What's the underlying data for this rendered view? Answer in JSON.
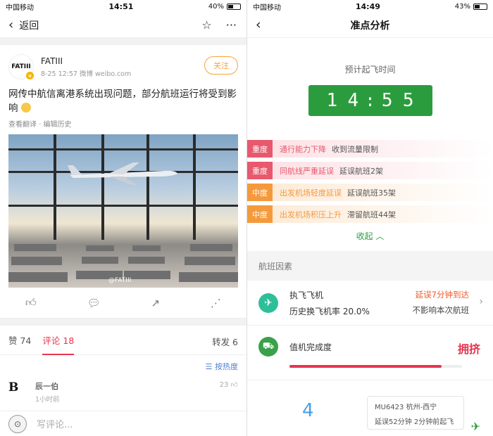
{
  "left": {
    "status": {
      "carrier": "中国移动",
      "time": "14:51",
      "battery": "40%",
      "battery_level": 0.4
    },
    "nav": {
      "back_label": "返回",
      "star_icon": "star-icon",
      "more_icon": "more-icon"
    },
    "post": {
      "avatar_text": "FATIII",
      "author": "FATIII",
      "meta": "8-25 12:57  微博 weibo.com",
      "follow_label": "关注",
      "text": "网传中航信离港系统出现问题，部分航班运行将受到影响",
      "sub": "查看翻译 · 编辑历史",
      "watermark": "@FATIII"
    },
    "tabs": {
      "likes": "赞 74",
      "comments": "评论 18",
      "reposts": "转发 6"
    },
    "sort_label": "按热度",
    "comment": {
      "avatar": "B",
      "name": "辰一伯",
      "time": "1小时前",
      "likes": "23"
    },
    "input_placeholder": "写评论..."
  },
  "right": {
    "status": {
      "carrier": "中国移动",
      "time": "14:49",
      "battery": "43%",
      "battery_level": 0.43
    },
    "title": "准点分析",
    "departure_label": "预计起飞时间",
    "departure_digits": [
      "1",
      "4",
      "5",
      "5"
    ],
    "factors": [
      {
        "severity": "重度",
        "title": "通行能力下降",
        "detail": "收到流量限制",
        "color": "#e8596e",
        "bg": "#fde2e6"
      },
      {
        "severity": "重度",
        "title": "同航线严重延误",
        "detail": "延误航班2架",
        "color": "#e8596e",
        "bg": "#fde2e6"
      },
      {
        "severity": "中度",
        "title": "出发机场轻度延误",
        "detail": "延误航班35架",
        "color": "#f59a3c",
        "bg": "#fdebd8"
      },
      {
        "severity": "中度",
        "title": "出发机场积压上升",
        "detail": "滞留航班44架",
        "color": "#f59a3c",
        "bg": "#fdebd8"
      }
    ],
    "collapse_label": "收起 ︿",
    "section_title": "航班因素",
    "aircraft": {
      "title": "执飞飞机",
      "sub": "历史换飞机率 20.0%",
      "delay": "延误7分钟到达",
      "note": "不影响本次航班"
    },
    "checkin": {
      "label": "值机完成度",
      "status": "拥挤",
      "level": 0.88
    },
    "bottom": {
      "number": "4",
      "flight": "MU6423 杭州-西宁",
      "flight_delay": "延误52分钟 2分钟前起飞"
    }
  }
}
